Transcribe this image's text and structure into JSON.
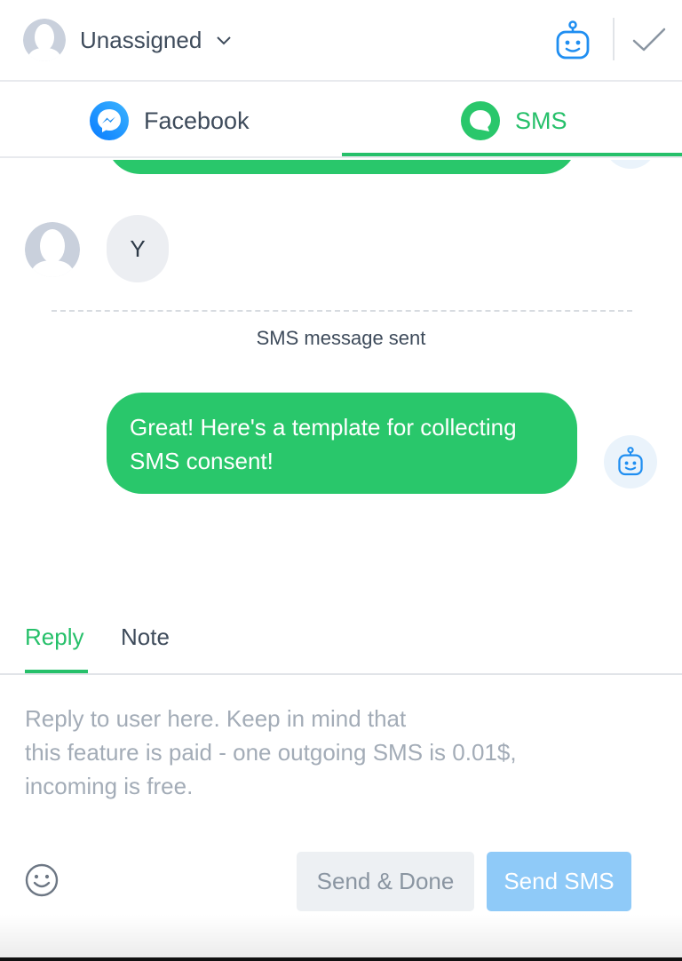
{
  "header": {
    "assignee_label": "Unassigned",
    "assignee_avatar_icon": "user-silhouette-icon",
    "dropdown_icon": "chevron-down-icon",
    "bot_icon": "bot-icon",
    "resolve_icon": "checkmark-icon"
  },
  "channels": {
    "tabs": [
      {
        "label": "Facebook",
        "icon": "messenger-icon",
        "active": false
      },
      {
        "label": "SMS",
        "icon": "sms-chat-icon",
        "active": true
      }
    ]
  },
  "conversation": {
    "incoming_message": "Y",
    "system_note": "SMS message sent",
    "outgoing_message": "Great! Here's a template for collecting SMS consent!"
  },
  "reply": {
    "tabs": [
      {
        "label": "Reply",
        "active": true
      },
      {
        "label": "Note",
        "active": false
      }
    ],
    "placeholder": "Reply to user here. Keep in mind that\nthis feature is paid - one outgoing SMS is 0.01$,\nincoming is free.",
    "emoji_icon": "smiley-icon",
    "send_done_label": "Send & Done",
    "send_label": "Send SMS"
  },
  "colors": {
    "accent_green": "#29c76b",
    "messenger_blue": "#1f8ef1",
    "send_button_blue": "#8fcaf8"
  }
}
